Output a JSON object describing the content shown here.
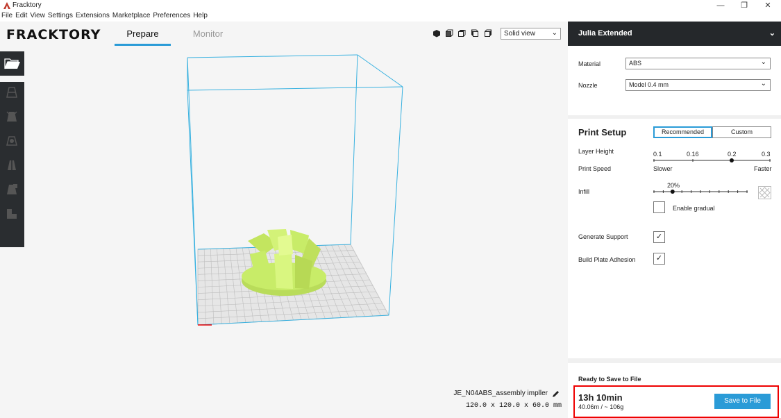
{
  "window": {
    "title": "Fracktory",
    "minimize": "—",
    "restore": "❐",
    "close": "✕"
  },
  "menu": [
    "File",
    "Edit",
    "View",
    "Settings",
    "Extensions",
    "Marketplace",
    "Preferences",
    "Help"
  ],
  "header": {
    "logo": "FRACKTORY",
    "tabs": [
      "Prepare",
      "Monitor"
    ],
    "view_mode": "Solid view"
  },
  "model": {
    "name": "JE_N04ABS_assembly impller",
    "dimensions": "120.0 x 120.0 x 60.0 mm"
  },
  "panel": {
    "printer": "Julia Extended",
    "material_label": "Material",
    "material_value": "ABS",
    "nozzle_label": "Nozzle",
    "nozzle_value": "Model 0.4 mm",
    "setup_title": "Print Setup",
    "mode_recommended": "Recommended",
    "mode_custom": "Custom",
    "layer_height_label": "Layer Height",
    "layer_height_ticks": [
      "0.1",
      "0.16",
      "0.2",
      "0.3"
    ],
    "layer_height_selected": "0.2",
    "print_speed_label": "Print Speed",
    "speed_slower": "Slower",
    "speed_faster": "Faster",
    "infill_label": "Infill",
    "infill_value": "20%",
    "infill_fraction": 0.2,
    "enable_gradual_label": "Enable gradual",
    "enable_gradual_checked": false,
    "generate_support_label": "Generate Support",
    "generate_support_checked": true,
    "build_plate_label": "Build Plate Adhesion",
    "build_plate_checked": true,
    "check_mark": "✓",
    "ready_label": "Ready to Save to File",
    "time_estimate": "13h 10min",
    "material_estimate": "40.06m / ~ 106g",
    "save_button": "Save to File"
  },
  "colors": {
    "accent": "#2a9bd7",
    "dark": "#25282b",
    "model": "#c8ec68",
    "highlight": "#e00000"
  }
}
